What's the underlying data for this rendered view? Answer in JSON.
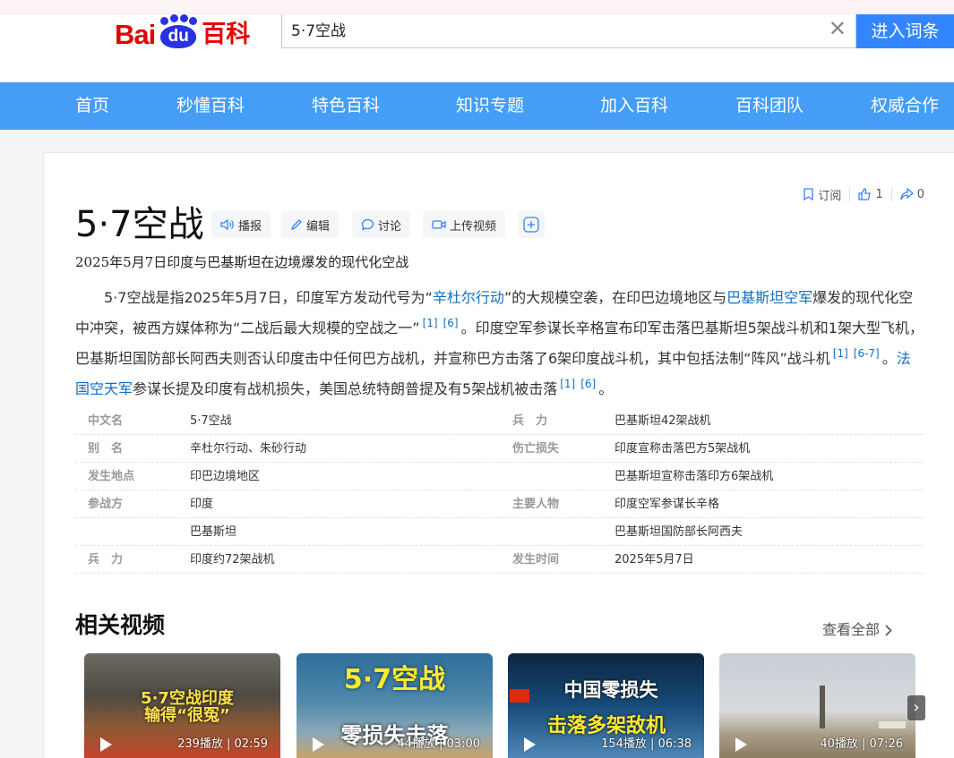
{
  "logo": {
    "part1": "Bai",
    "part2": "du",
    "part3": "百科"
  },
  "search": {
    "value": "5·7空战",
    "button_label": "进入词条"
  },
  "nav": [
    "首页",
    "秒懂百科",
    "特色百科",
    "知识专题",
    "加入百科",
    "百科团队",
    "权威合作"
  ],
  "actions_right": {
    "subscribe": "订阅",
    "likes": "1",
    "shares": "0"
  },
  "title": "5·7空战",
  "tools": {
    "broadcast": "播报",
    "edit": "编辑",
    "discuss": "讨论",
    "upload_video": "上传视频"
  },
  "subtitle": "2025年5月7日印度与巴基斯坦在边境爆发的现代化空战",
  "summary": {
    "p1": "5·7空战是指2025年5月7日，印度军方发动代号为“",
    "link1": "辛杜尔行动",
    "p2": "”的大规模空袭，在印巴边境地区与",
    "link2": "巴基斯坦空军",
    "p3": "爆发的现代化空中冲突，被西方媒体称为“二战后最大规模的空战之一”",
    "ref1": "[1]",
    "ref2": "[6]",
    "p4": "。印度空军参谋长辛格宣布印军击落巴基斯坦5架战斗机和1架大型飞机，巴基斯坦国防部长阿西夫则否认印度击中任何巴方战机，并宣称巴方击落了6架印度战斗机，其中包括法制“阵风”战斗机",
    "ref3": "[1]",
    "ref4": "[6-7]",
    "p5": "。",
    "link3": "法国空天军",
    "p6": "参谋长提及印度有战机损失，美国总统特朗普提及有5架战机被击落",
    "ref5": "[1]",
    "ref6": "[6]",
    "p7": "。"
  },
  "info": [
    {
      "l1": "中文名",
      "v1": "5·7空战",
      "l2": "兵　力",
      "v2": "巴基斯坦42架战机"
    },
    {
      "l1": "别　名",
      "v1": "辛杜尔行动、朱砂行动",
      "l2": "伤亡损失",
      "v2": "印度宣称击落巴方5架战机"
    },
    {
      "l1": "发生地点",
      "v1": "印巴边境地区",
      "l2": "",
      "v2": "巴基斯坦宣称击落印方6架战机"
    },
    {
      "l1": "参战方",
      "v1": "印度",
      "l2": "主要人物",
      "v2": "印度空军参谋长辛格"
    },
    {
      "l1": "",
      "v1": "巴基斯坦",
      "l2": "",
      "v2": "巴基斯坦国防部长阿西夫"
    },
    {
      "l1": "兵　力",
      "v1": "印度约72架战机",
      "l2": "发生时间",
      "v2": "2025年5月7日"
    }
  ],
  "related_videos": {
    "title": "相关视频",
    "more": "查看全部",
    "items": [
      {
        "caption": "5·7空战印度\n输得“很冤”",
        "stats": "239播放 | 02:59"
      },
      {
        "caption": "5·7空战",
        "caption2": "零损失击落",
        "stats": "44播放 | 03:00"
      },
      {
        "caption": "中国零损失",
        "caption2": "击落多架敌机",
        "stats": "154播放 | 06:38"
      },
      {
        "caption": "",
        "stats": "40播放 | 07:26"
      }
    ]
  }
}
